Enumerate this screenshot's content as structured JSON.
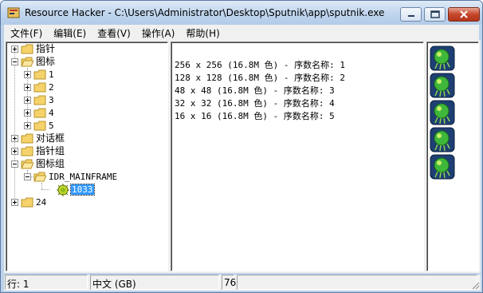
{
  "window": {
    "title": "Resource Hacker  - C:\\Users\\Administrator\\Desktop\\Sputnik\\app\\sputnik.exe"
  },
  "menu": [
    {
      "label": "文件(F)"
    },
    {
      "label": "编辑(E)"
    },
    {
      "label": "查看(V)"
    },
    {
      "label": "操作(A)"
    },
    {
      "label": "帮助(H)"
    }
  ],
  "tree": {
    "cursor": "指针",
    "icon": "图标",
    "icon_children": [
      "1",
      "2",
      "3",
      "4",
      "5"
    ],
    "dialog": "对话框",
    "cursor_group": "指针组",
    "icon_group": "图标组",
    "mainframe": "IDR_MAINFRAME",
    "language_id": "1033",
    "manifest": "24"
  },
  "text_pane": {
    "lines": [
      "256 x 256 (16.8M 色) - 序数名称: 1",
      "128 x 128 (16.8M 色) - 序数名称: 2",
      "48 x 48 (16.8M 色) - 序数名称: 3",
      "32 x 32 (16.8M 色) - 序数名称: 4",
      "16 x 16 (16.8M 色) - 序数名称: 5"
    ]
  },
  "status": {
    "line": "行: 1",
    "language": "中文 (GB)",
    "value": "76"
  },
  "colors": {
    "selection": "#3399ff",
    "folder": "#f5d36a"
  },
  "icons": {
    "app": "resource-hacker-icon",
    "folder": "folder-icon",
    "resource": "green-bug-icon",
    "language": "language-resource-icon"
  }
}
